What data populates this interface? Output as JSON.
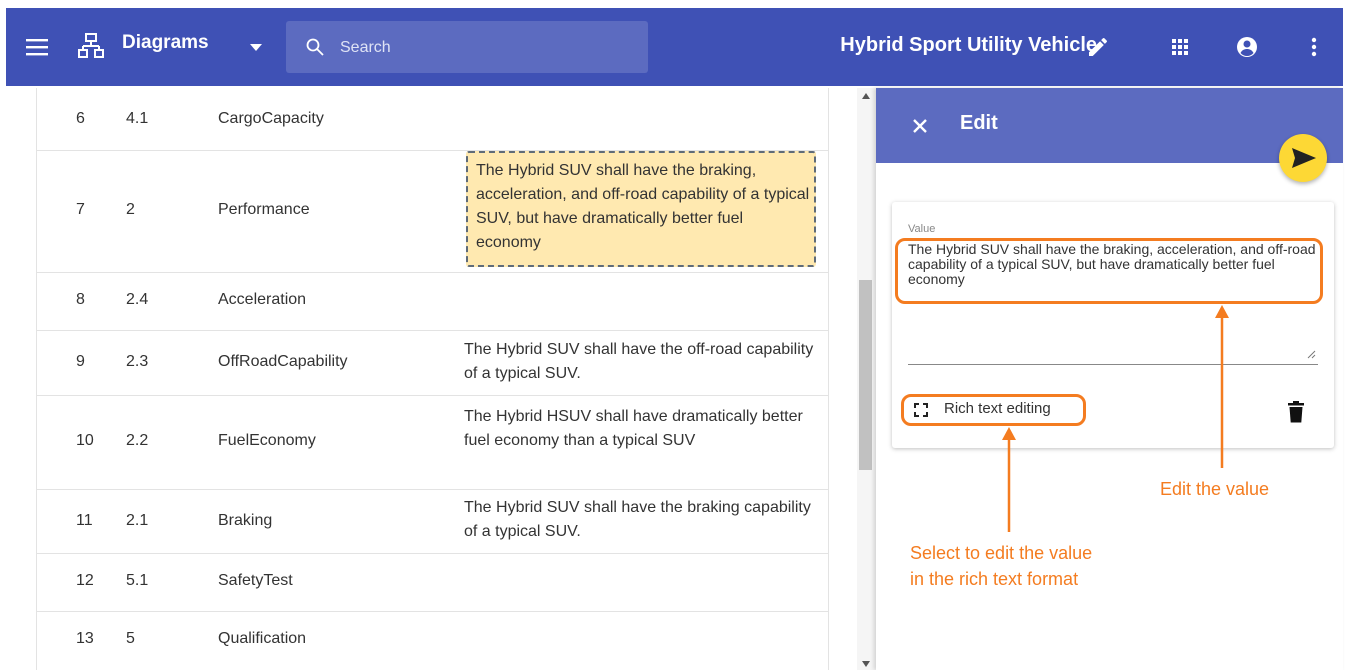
{
  "app": {
    "title": "Diagrams",
    "search_placeholder": "Search",
    "document_title": "Hybrid Sport Utility Vehicle"
  },
  "table": {
    "rows": [
      {
        "num": "6",
        "id": "4.1",
        "name": "CargoCapacity",
        "text": ""
      },
      {
        "num": "7",
        "id": "2",
        "name": "Performance",
        "text": "The Hybrid SUV shall have the braking, acceleration, and off-road capability of a typical SUV, but have dramatically better fuel economy"
      },
      {
        "num": "8",
        "id": "2.4",
        "name": "Acceleration",
        "text": ""
      },
      {
        "num": "9",
        "id": "2.3",
        "name": "OffRoadCapability",
        "text": "The Hybrid SUV shall have the off-road capability of a typical SUV."
      },
      {
        "num": "10",
        "id": "2.2",
        "name": "FuelEconomy",
        "text": "The Hybrid HSUV shall have dramatically better fuel economy than a typical SUV"
      },
      {
        "num": "11",
        "id": "2.1",
        "name": "Braking",
        "text": "The Hybrid SUV shall have the braking capability of a typical SUV."
      },
      {
        "num": "12",
        "id": "5.1",
        "name": "SafetyTest",
        "text": ""
      },
      {
        "num": "13",
        "id": "5",
        "name": "Qualification",
        "text": ""
      }
    ]
  },
  "panel": {
    "title": "Edit",
    "field_label": "Value",
    "value": "The Hybrid SUV shall have the braking, acceleration, and off-road capability of a typical SUV, but have dramatically better fuel economy",
    "rich_text_label": "Rich text editing"
  },
  "annotations": {
    "edit_value": "Edit the value",
    "rich_text_line1": "Select to edit the value",
    "rich_text_line2": "in the rich text format"
  },
  "colors": {
    "appbar": "#3f51b5",
    "panel_header": "#5c6bc0",
    "highlight": "#ffe9b0",
    "fab": "#fdd835",
    "callout": "#f47c20"
  }
}
